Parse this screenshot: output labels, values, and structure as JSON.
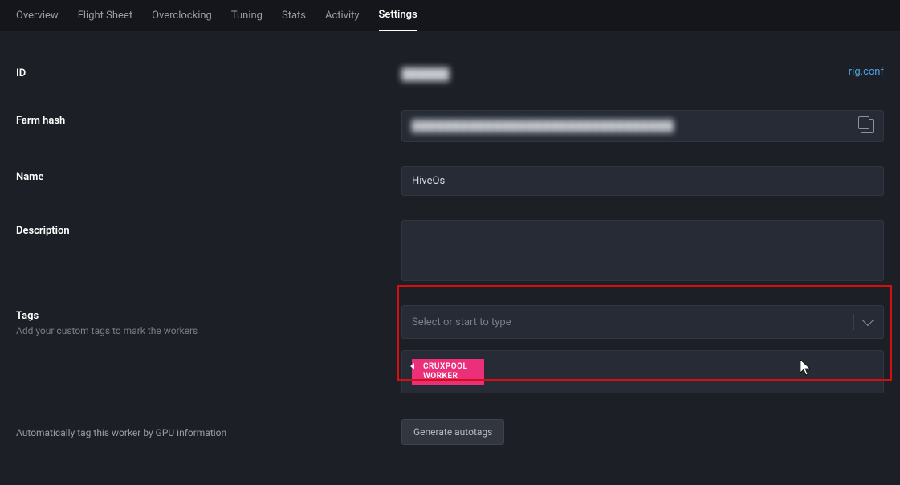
{
  "tabs": [
    {
      "label": "Overview"
    },
    {
      "label": "Flight Sheet"
    },
    {
      "label": "Overclocking"
    },
    {
      "label": "Tuning"
    },
    {
      "label": "Stats"
    },
    {
      "label": "Activity"
    },
    {
      "label": "Settings",
      "active": true
    }
  ],
  "rigconf_link": "rig.conf",
  "fields": {
    "id": {
      "label": "ID",
      "value": "██████"
    },
    "farmhash": {
      "label": "Farm hash",
      "value": "████████████████████████████████"
    },
    "name": {
      "label": "Name",
      "value": "HiveOs"
    },
    "description": {
      "label": "Description",
      "value": ""
    },
    "tags": {
      "label": "Tags",
      "sub": "Add your custom tags to mark the workers",
      "placeholder": "Select or start to type",
      "applied": [
        "CRUXPOOL WORKER"
      ]
    },
    "autotags": {
      "label": "Automatically tag this worker by GPU information",
      "button": "Generate autotags"
    }
  }
}
